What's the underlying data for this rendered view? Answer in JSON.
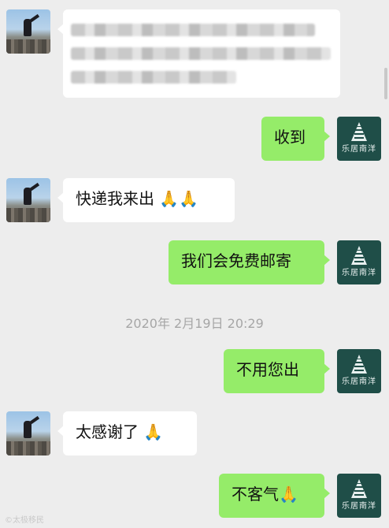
{
  "messages": [
    {
      "side": "left",
      "text": ""
    },
    {
      "side": "right",
      "text": "收到"
    },
    {
      "side": "left",
      "text": "快递我来出 🙏🙏"
    },
    {
      "side": "right",
      "text": "我们会免费邮寄"
    },
    {
      "timestamp": "2020年 2月19日 20:29"
    },
    {
      "side": "right",
      "text": "不用您出"
    },
    {
      "side": "left",
      "text": "太感谢了 🙏"
    },
    {
      "side": "right",
      "text": "不客气🙏"
    }
  ],
  "brand": {
    "label": "乐居南洋"
  },
  "watermark": {
    "text": "©太极移民"
  },
  "colors": {
    "sent": "#95ec69",
    "received": "#ffffff",
    "background": "#ededed"
  }
}
